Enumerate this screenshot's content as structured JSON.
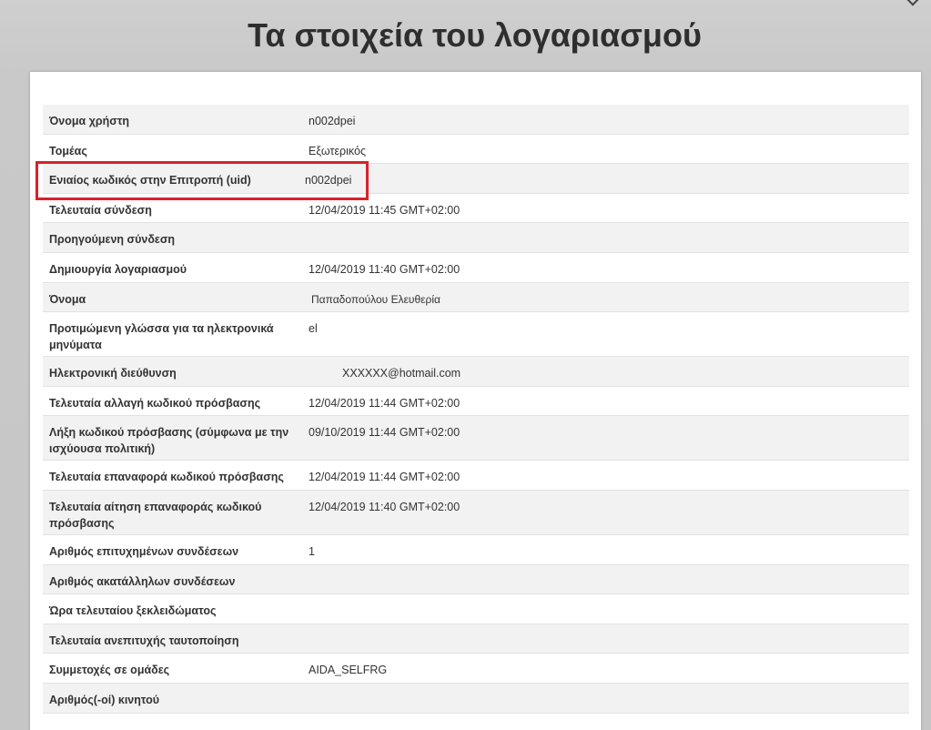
{
  "page": {
    "title": "Τα στοιχεία του λογαριασμού"
  },
  "account_rows": [
    {
      "label": "Όνομα χρήστη",
      "value": "n002dpei"
    },
    {
      "label": "Τομέας",
      "value": "Εξωτερικός"
    },
    {
      "label": "Ενιαίος κωδικός στην Επιτροπή (uid)",
      "value": "n002dpei",
      "highlighted": true
    },
    {
      "label": "Τελευταία σύνδεση",
      "value": "12/04/2019 11:45 GMT+02:00"
    },
    {
      "label": "Προηγούμενη σύνδεση",
      "value": ""
    },
    {
      "label": "Δημιουργία λογαριασμού",
      "value": "12/04/2019 11:40 GMT+02:00"
    },
    {
      "label": "Όνομα",
      "value": "Παπαδοπούλου Ελευθερία"
    },
    {
      "label": "Προτιμώμενη γλώσσα για τα ηλεκτρονικά μηνύματα",
      "value": "el"
    },
    {
      "label": "Ηλεκτρονική διεύθυνση",
      "value": "XXXXXX@hotmail.com"
    },
    {
      "label": "Τελευταία αλλαγή κωδικού πρόσβασης",
      "value": "12/04/2019 11:44 GMT+02:00"
    },
    {
      "label": "Λήξη κωδικού πρόσβασης (σύμφωνα με την ισχύουσα πολιτική)",
      "value": "09/10/2019 11:44 GMT+02:00"
    },
    {
      "label": "Τελευταία επαναφορά κωδικού πρόσβασης",
      "value": "12/04/2019 11:44 GMT+02:00"
    },
    {
      "label": "Τελευταία αίτηση επαναφοράς κωδικού πρόσβασης",
      "value": "12/04/2019 11:40 GMT+02:00"
    },
    {
      "label": "Αριθμός επιτυχημένων συνδέσεων",
      "value": "1"
    },
    {
      "label": "Αριθμός ακατάλληλων συνδέσεων",
      "value": ""
    },
    {
      "label": "Ώρα τελευταίου ξεκλειδώματος",
      "value": ""
    },
    {
      "label": "Τελευταία ανεπιτυχής ταυτοποίηση",
      "value": ""
    },
    {
      "label": "Συμμετοχές σε ομάδες",
      "value": "AIDA_SELFRG"
    },
    {
      "label": "Αριθμός(-οί) κινητού",
      "value": ""
    }
  ],
  "colors": {
    "highlight_border": "#d8222b",
    "row_alt": "#f2f2f2"
  }
}
